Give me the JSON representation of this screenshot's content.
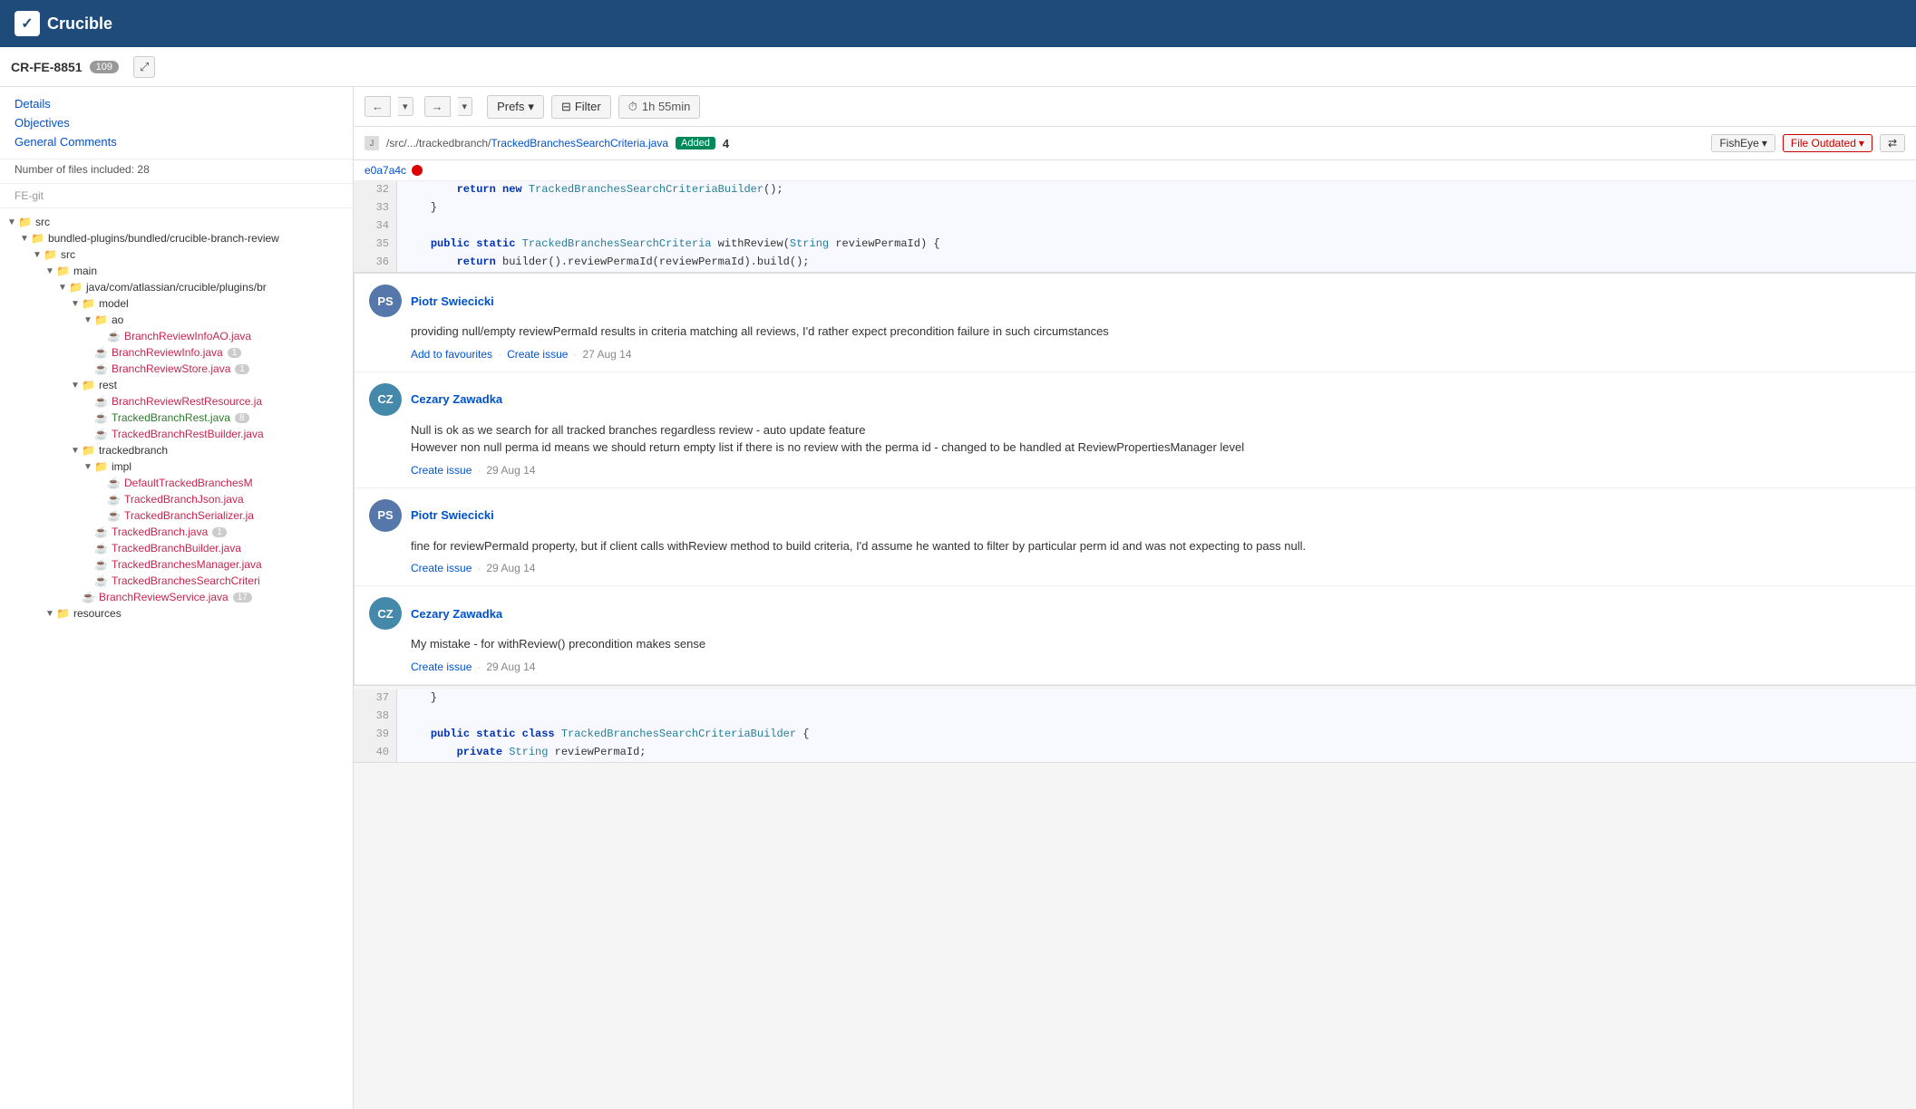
{
  "app": {
    "name": "Crucible",
    "logo_char": "✓"
  },
  "sub_header": {
    "review_id": "CR-FE-8851",
    "badge_count": "109",
    "expand_label": "⤢"
  },
  "toolbar": {
    "nav_back": "←",
    "nav_fwd": "→",
    "nav_dropdown": "▾",
    "prefs_label": "Prefs",
    "prefs_dropdown": "▾",
    "filter_icon": "⊟",
    "filter_label": "Filter",
    "timer_icon": "⏱",
    "timer_label": "1h 55min"
  },
  "sidebar": {
    "nav_links": [
      "Details",
      "Objectives",
      "General Comments"
    ],
    "meta_label": "Number of files included: 28",
    "repo_label": "FE-git",
    "tree": [
      {
        "indent": 0,
        "type": "folder",
        "expanded": true,
        "label": "src",
        "badge": null
      },
      {
        "indent": 1,
        "type": "folder",
        "expanded": true,
        "label": "bundled-plugins/bundled/crucible-branch-review",
        "badge": null
      },
      {
        "indent": 2,
        "type": "folder",
        "expanded": true,
        "label": "src",
        "badge": null
      },
      {
        "indent": 3,
        "type": "folder",
        "expanded": true,
        "label": "main",
        "badge": null
      },
      {
        "indent": 4,
        "type": "folder",
        "expanded": true,
        "label": "java/com/atlassian/crucible/plugins/br",
        "badge": null
      },
      {
        "indent": 5,
        "type": "folder",
        "expanded": true,
        "label": "model",
        "badge": null
      },
      {
        "indent": 6,
        "type": "folder",
        "expanded": true,
        "label": "ao",
        "badge": null
      },
      {
        "indent": 7,
        "type": "file",
        "color": "red",
        "label": "BranchReviewInfoAO.java",
        "badge": null
      },
      {
        "indent": 6,
        "type": "file",
        "color": "red",
        "label": "BranchReviewInfo.java",
        "badge": "1"
      },
      {
        "indent": 6,
        "type": "file",
        "color": "red",
        "label": "BranchReviewStore.java",
        "badge": "1"
      },
      {
        "indent": 5,
        "type": "folder",
        "expanded": true,
        "label": "rest",
        "badge": null
      },
      {
        "indent": 6,
        "type": "file",
        "color": "red",
        "label": "BranchReviewRestResource.ja",
        "badge": null
      },
      {
        "indent": 6,
        "type": "file",
        "color": "green",
        "label": "TrackedBranchRest.java",
        "badge": "8"
      },
      {
        "indent": 6,
        "type": "file",
        "color": "red",
        "label": "TrackedBranchRestBuilder.java",
        "badge": null
      },
      {
        "indent": 5,
        "type": "folder",
        "expanded": true,
        "label": "trackedbranch",
        "badge": null
      },
      {
        "indent": 6,
        "type": "folder",
        "expanded": true,
        "label": "impl",
        "badge": null
      },
      {
        "indent": 7,
        "type": "file",
        "color": "red",
        "label": "DefaultTrackedBranchesM",
        "badge": null
      },
      {
        "indent": 7,
        "type": "file",
        "color": "red",
        "label": "TrackedBranchJson.java",
        "badge": null
      },
      {
        "indent": 7,
        "type": "file",
        "color": "red",
        "label": "TrackedBranchSerializer.ja",
        "badge": null
      },
      {
        "indent": 6,
        "type": "file",
        "color": "red",
        "label": "TrackedBranch.java",
        "badge": "1"
      },
      {
        "indent": 6,
        "type": "file",
        "color": "red",
        "label": "TrackedBranchBuilder.java",
        "badge": null
      },
      {
        "indent": 6,
        "type": "file",
        "color": "red",
        "label": "TrackedBranchesManager.java",
        "badge": null
      },
      {
        "indent": 6,
        "type": "file",
        "color": "red",
        "label": "TrackedBranchesSearchCriteri",
        "badge": null
      },
      {
        "indent": 5,
        "type": "file",
        "color": "red",
        "label": "BranchReviewService.java",
        "badge": "17"
      },
      {
        "indent": 3,
        "type": "folder",
        "expanded": true,
        "label": "resources",
        "badge": null
      }
    ]
  },
  "file_bar": {
    "path_prefix": "/src/.../trackedbranch/",
    "file_name": "TrackedBranchesSearchCriteria.java",
    "status_badge": "Added",
    "comment_count": "4",
    "fisheye_label": "FishEye",
    "file_outdated_label": "File Outdated",
    "compare_icon": "⇄"
  },
  "commit": {
    "hash": "e0a7a4c"
  },
  "code_lines": [
    {
      "num": "32",
      "content": "        return new TrackedBranchesSearchCriteriaBuilder();"
    },
    {
      "num": "33",
      "content": "    }"
    },
    {
      "num": "34",
      "content": ""
    },
    {
      "num": "35",
      "content": "    public static TrackedBranchesSearchCriteria withReview(String reviewPermaId) {"
    },
    {
      "num": "36",
      "content": "        return builder().reviewPermaId(reviewPermaId).build();"
    }
  ],
  "code_lines_bottom": [
    {
      "num": "37",
      "content": "    }"
    },
    {
      "num": "38",
      "content": ""
    },
    {
      "num": "39",
      "content": "    public static class TrackedBranchesSearchCriteriaBuilder {"
    },
    {
      "num": "40",
      "content": "        private String reviewPermaId;"
    }
  ],
  "comments": [
    {
      "id": "c1",
      "author": "Piotr Swiecicki",
      "avatar_initials": "PS",
      "avatar_class": "avatar-ps",
      "body": "providing null/empty reviewPermaId results in criteria matching all reviews, I'd rather expect precondition failure in such circumstances",
      "actions": [
        "Add to favourites",
        "Create issue"
      ],
      "date": "27 Aug 14"
    },
    {
      "id": "c2",
      "author": "Cezary Zawadka",
      "avatar_initials": "CZ",
      "avatar_class": "avatar-cz",
      "body": "Null is ok as we search for all tracked branches regardless review - auto update feature\nHowever non null perma id means we should return empty list if there is no review with the perma id - changed to be handled at ReviewPropertiesManager level",
      "actions": [
        "Create issue"
      ],
      "date": "29 Aug 14"
    },
    {
      "id": "c3",
      "author": "Piotr Swiecicki",
      "avatar_initials": "PS",
      "avatar_class": "avatar-ps",
      "body": "fine for reviewPermaId property, but if client calls withReview method to build criteria, I'd assume he wanted to filter by particular perm id and was not expecting to pass null.",
      "actions": [
        "Create issue"
      ],
      "date": "29 Aug 14"
    },
    {
      "id": "c4",
      "author": "Cezary Zawadka",
      "avatar_initials": "CZ",
      "avatar_class": "avatar-cz",
      "body": "My mistake - for withReview() precondition makes sense",
      "actions": [
        "Create issue"
      ],
      "date": "29 Aug 14"
    }
  ]
}
